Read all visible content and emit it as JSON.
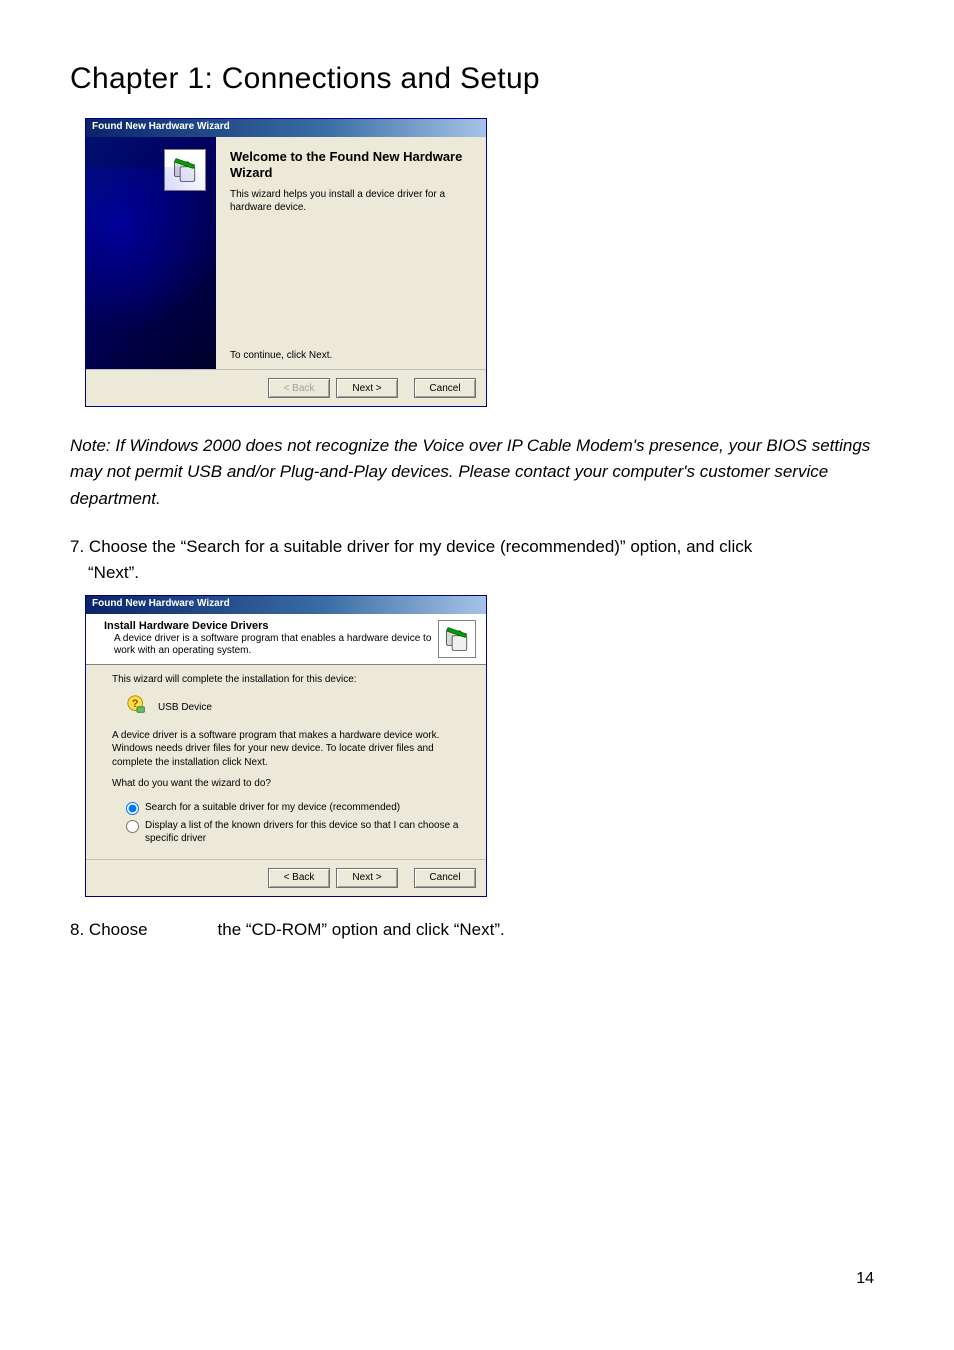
{
  "chapterTitle": "Chapter 1: Connections and Setup",
  "wizard1": {
    "title": "Found New Hardware Wizard",
    "welcomeTitle": "Welcome to the Found New Hardware Wizard",
    "welcomeSub": "This wizard helps you install a device driver for a hardware device.",
    "continueText": "To continue, click Next.",
    "buttons": {
      "back": "< Back",
      "next": "Next >",
      "cancel": "Cancel"
    }
  },
  "note": "Note: If Windows 2000 does not recognize the Voice over IP Cable Modem's presence, your BIOS settings may not permit USB and/or Plug-and-Play devices. Please contact your computer's customer service department.",
  "step7": {
    "number": "7.",
    "textA": "Choose the “Search for a suitable driver for my device (recommended)” option, and click",
    "textB": "“Next”."
  },
  "wizard2": {
    "title": "Found New Hardware Wizard",
    "headerTitle": "Install Hardware Device Drivers",
    "headerSub": "A device driver is a software program that enables a hardware device to work with an operating system.",
    "line1": "This wizard will complete the installation for this device:",
    "deviceName": "USB Device",
    "line2": "A device driver is a software program that makes a hardware device work. Windows needs driver files for your new device. To locate driver files and complete the installation click Next.",
    "question": "What do you want the wizard to do?",
    "option1": "Search for a suitable driver for my device (recommended)",
    "option2": "Display a list of the known drivers for this device so that I can choose a specific driver",
    "buttons": {
      "back": "< Back",
      "next": "Next >",
      "cancel": "Cancel"
    }
  },
  "step8": {
    "number": "8.",
    "textA": "Choose",
    "textB": "the “CD-ROM” option and click “Next”."
  },
  "pageNumber": "14"
}
